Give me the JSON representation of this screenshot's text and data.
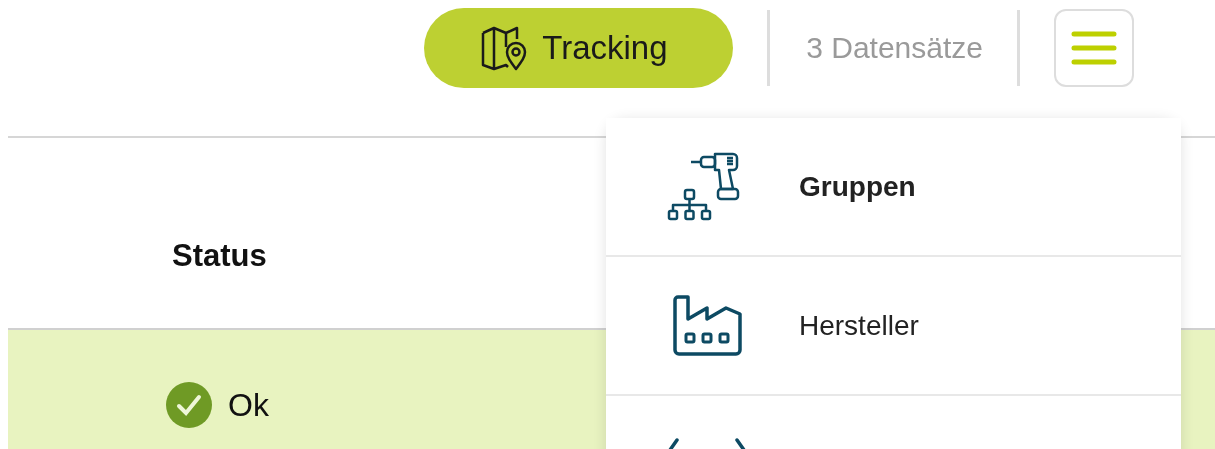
{
  "toolbar": {
    "tracking_button": "Tracking",
    "record_count": "3 Datensätze"
  },
  "table": {
    "columns": [
      "Status"
    ],
    "rows": [
      {
        "status": "Ok",
        "selected": true
      }
    ]
  },
  "menu": {
    "items": [
      {
        "label": "Gruppen",
        "selected": true
      },
      {
        "label": "Hersteller",
        "selected": false
      }
    ]
  }
}
